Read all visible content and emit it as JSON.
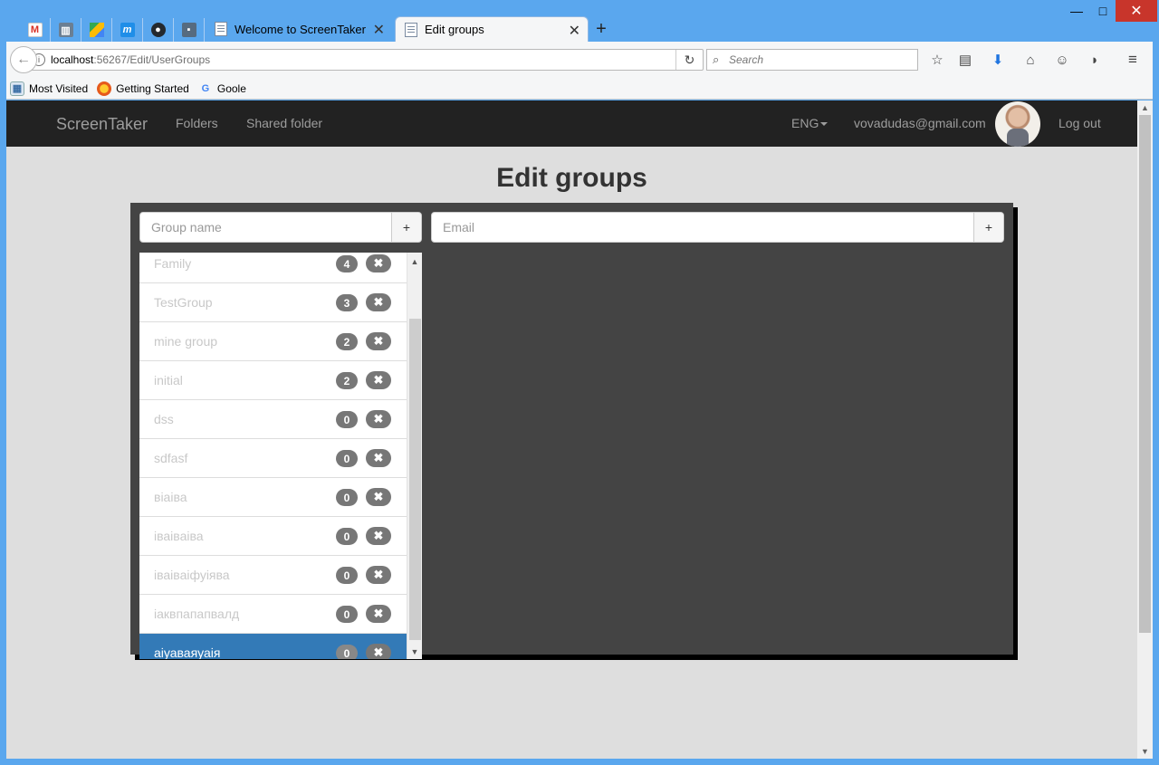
{
  "browser": {
    "window_controls": {
      "minimize": "—",
      "maximize": "□",
      "close": "✕"
    },
    "tabs": [
      {
        "title": "Welcome to ScreenTaker",
        "active": false
      },
      {
        "title": "Edit groups",
        "active": true
      }
    ],
    "new_tab": "+",
    "url_host": "localhost",
    "url_path": ":56267/Edit/UserGroups",
    "search_placeholder": "Search",
    "bookmarks": [
      "Most Visited",
      "Getting Started",
      "Goole"
    ]
  },
  "app": {
    "brand": "ScreenTaker",
    "nav": {
      "folders": "Folders",
      "shared": "Shared folder"
    },
    "lang": "ENG",
    "user_email": "vovadudas@gmail.com",
    "logout": "Log out"
  },
  "page": {
    "title": "Edit groups",
    "group_input_placeholder": "Group name",
    "email_input_placeholder": "Email",
    "add_label": "+",
    "delete_glyph": "✖"
  },
  "groups": [
    {
      "name": "Family",
      "count": "4",
      "active": false
    },
    {
      "name": "TestGroup",
      "count": "3",
      "active": false
    },
    {
      "name": "mine group",
      "count": "2",
      "active": false
    },
    {
      "name": "initial",
      "count": "2",
      "active": false
    },
    {
      "name": "dss",
      "count": "0",
      "active": false
    },
    {
      "name": "sdfasf",
      "count": "0",
      "active": false
    },
    {
      "name": "віаіва",
      "count": "0",
      "active": false
    },
    {
      "name": "іваіваіва",
      "count": "0",
      "active": false
    },
    {
      "name": "іваіваіфуіява",
      "count": "0",
      "active": false
    },
    {
      "name": "іаквпапапвалд",
      "count": "0",
      "active": false
    },
    {
      "name": "аіуаваяуаія",
      "count": "0",
      "active": true
    }
  ],
  "colors": {
    "navbar_bg": "#222222",
    "panel_bg": "#444444",
    "active_item": "#337ab7",
    "badge": "#777777"
  }
}
